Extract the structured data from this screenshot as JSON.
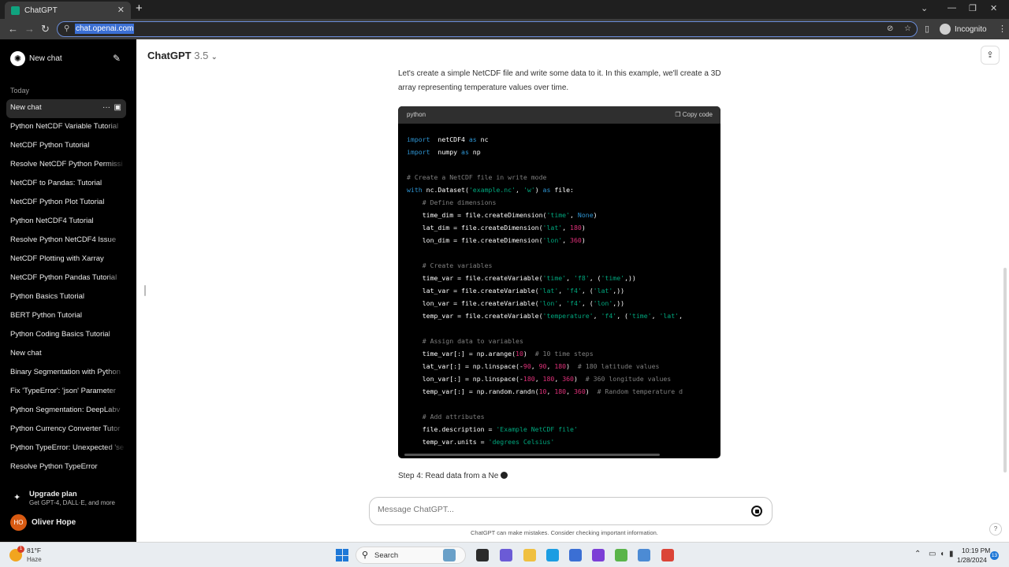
{
  "browser": {
    "tab_title": "ChatGPT",
    "tab_close": "✕",
    "new_tab": "+",
    "url": "chat.openai.com",
    "profile_label": "Incognito",
    "window_controls": [
      "⌄",
      "—",
      "❐",
      "✕"
    ]
  },
  "sidebar": {
    "new_chat_label": "New chat",
    "section_label": "Today",
    "items": [
      {
        "label": "New chat",
        "active": true
      },
      {
        "label": "Python NetCDF Variable Tutorial"
      },
      {
        "label": "NetCDF Python Tutorial"
      },
      {
        "label": "Resolve NetCDF Python Permissi"
      },
      {
        "label": "NetCDF to Pandas: Tutorial"
      },
      {
        "label": "NetCDF Python Plot Tutorial"
      },
      {
        "label": "Python NetCDF4 Tutorial"
      },
      {
        "label": "Resolve Python NetCDF4 Issue"
      },
      {
        "label": "NetCDF Plotting with Xarray"
      },
      {
        "label": "NetCDF Python Pandas Tutorial"
      },
      {
        "label": "Python Basics Tutorial"
      },
      {
        "label": "BERT Python Tutorial"
      },
      {
        "label": "Python Coding Basics Tutorial"
      },
      {
        "label": "New chat"
      },
      {
        "label": "Binary Segmentation with Python"
      },
      {
        "label": "Fix 'TypeError': 'json' Parameter"
      },
      {
        "label": "Python Segmentation: DeepLabv"
      },
      {
        "label": "Python Currency Converter Tutor"
      },
      {
        "label": "Python TypeError: Unexpected 'se"
      },
      {
        "label": "Resolve Python TypeError"
      }
    ],
    "upgrade_title": "Upgrade plan",
    "upgrade_subtitle": "Get GPT-4, DALL·E, and more",
    "user_initials": "HO",
    "user_name": "Oliver Hope"
  },
  "main": {
    "model_name": "ChatGPT",
    "model_version": " 3.5",
    "intro_text": "Let's create a simple NetCDF file and write some data to it. In this example, we'll create a 3D array representing temperature values over time.",
    "code_language": "python",
    "copy_label": "Copy code",
    "code_lines": [
      [
        [
          "kw",
          "import"
        ],
        [
          "",
          "  netCDF4 "
        ],
        [
          "kw",
          "as"
        ],
        [
          "",
          " nc"
        ]
      ],
      [
        [
          "kw",
          "import"
        ],
        [
          "",
          "  numpy "
        ],
        [
          "kw",
          "as"
        ],
        [
          "",
          " np"
        ]
      ],
      [],
      [
        [
          "cm",
          "# Create a NetCDF file in write mode"
        ]
      ],
      [
        [
          "kw",
          "with"
        ],
        [
          "",
          " nc.Dataset("
        ],
        [
          "st",
          "'example.nc'"
        ],
        [
          "",
          ", "
        ],
        [
          "st",
          "'w'"
        ],
        [
          "",
          ") "
        ],
        [
          "kw",
          "as"
        ],
        [
          "",
          " file:"
        ]
      ],
      [
        [
          "cm",
          "    # Define dimensions"
        ]
      ],
      [
        [
          "",
          "    time_dim = file.createDimension("
        ],
        [
          "st",
          "'time'"
        ],
        [
          "",
          ", "
        ],
        [
          "kw",
          "None"
        ],
        [
          "",
          ")"
        ]
      ],
      [
        [
          "",
          "    lat_dim = file.createDimension("
        ],
        [
          "st",
          "'lat'"
        ],
        [
          "",
          ", "
        ],
        [
          "nm",
          "180"
        ],
        [
          "",
          ")"
        ]
      ],
      [
        [
          "",
          "    lon_dim = file.createDimension("
        ],
        [
          "st",
          "'lon'"
        ],
        [
          "",
          ", "
        ],
        [
          "nm",
          "360"
        ],
        [
          "",
          ")"
        ]
      ],
      [],
      [
        [
          "cm",
          "    # Create variables"
        ]
      ],
      [
        [
          "",
          "    time_var = file.createVariable("
        ],
        [
          "st",
          "'time'"
        ],
        [
          "",
          ", "
        ],
        [
          "st",
          "'f8'"
        ],
        [
          "",
          ", ("
        ],
        [
          "st",
          "'time'"
        ],
        [
          "",
          ",))"
        ]
      ],
      [
        [
          "",
          "    lat_var = file.createVariable("
        ],
        [
          "st",
          "'lat'"
        ],
        [
          "",
          ", "
        ],
        [
          "st",
          "'f4'"
        ],
        [
          "",
          ", ("
        ],
        [
          "st",
          "'lat'"
        ],
        [
          "",
          ",))"
        ]
      ],
      [
        [
          "",
          "    lon_var = file.createVariable("
        ],
        [
          "st",
          "'lon'"
        ],
        [
          "",
          ", "
        ],
        [
          "st",
          "'f4'"
        ],
        [
          "",
          ", ("
        ],
        [
          "st",
          "'lon'"
        ],
        [
          "",
          ",))"
        ]
      ],
      [
        [
          "",
          "    temp_var = file.createVariable("
        ],
        [
          "st",
          "'temperature'"
        ],
        [
          "",
          ", "
        ],
        [
          "st",
          "'f4'"
        ],
        [
          "",
          ", ("
        ],
        [
          "st",
          "'time'"
        ],
        [
          "",
          ", "
        ],
        [
          "st",
          "'lat'"
        ],
        [
          "",
          ","
        ]
      ],
      [],
      [
        [
          "cm",
          "    # Assign data to variables"
        ]
      ],
      [
        [
          "",
          "    time_var[:] = np.arange("
        ],
        [
          "nm",
          "10"
        ],
        [
          "",
          ")  "
        ],
        [
          "cm",
          "# 10 time steps"
        ]
      ],
      [
        [
          "",
          "    lat_var[:] = np.linspace(-"
        ],
        [
          "nm",
          "90"
        ],
        [
          "",
          ", "
        ],
        [
          "nm",
          "90"
        ],
        [
          "",
          ", "
        ],
        [
          "nm",
          "180"
        ],
        [
          "",
          ")  "
        ],
        [
          "cm",
          "# 180 latitude values"
        ]
      ],
      [
        [
          "",
          "    lon_var[:] = np.linspace(-"
        ],
        [
          "nm",
          "180"
        ],
        [
          "",
          ", "
        ],
        [
          "nm",
          "180"
        ],
        [
          "",
          ", "
        ],
        [
          "nm",
          "360"
        ],
        [
          "",
          ")  "
        ],
        [
          "cm",
          "# 360 longitude values"
        ]
      ],
      [
        [
          "",
          "    temp_var[:] = np.random.randn("
        ],
        [
          "nm",
          "10"
        ],
        [
          "",
          ", "
        ],
        [
          "nm",
          "180"
        ],
        [
          "",
          ", "
        ],
        [
          "nm",
          "360"
        ],
        [
          "",
          ")  "
        ],
        [
          "cm",
          "# Random temperature d"
        ]
      ],
      [],
      [
        [
          "cm",
          "    # Add attributes"
        ]
      ],
      [
        [
          "",
          "    file.description = "
        ],
        [
          "st",
          "'Example NetCDF file'"
        ]
      ],
      [
        [
          "",
          "    temp_var.units = "
        ],
        [
          "st",
          "'degrees Celsius'"
        ]
      ]
    ],
    "step_text": "Step 4: Read data from a Ne",
    "composer_placeholder": "Message ChatGPT...",
    "disclaimer": "ChatGPT can make mistakes. Consider checking important information.",
    "help_label": "?"
  },
  "taskbar": {
    "weather_badge": "1",
    "temperature": "81°F",
    "condition": "Haze",
    "search_label": "Search",
    "time": "10:19 PM",
    "date": "1/28/2024",
    "notification_count": "13",
    "apps": [
      {
        "icon": "people-app-icon",
        "color": "#6aa0c8"
      },
      {
        "icon": "task-view-icon",
        "color": "#2b2b2b"
      },
      {
        "icon": "chat-icon",
        "color": "#6b5bd6"
      },
      {
        "icon": "file-explorer-icon",
        "color": "#f0c040"
      },
      {
        "icon": "edge-icon",
        "color": "#1b9de2"
      },
      {
        "icon": "store-icon",
        "color": "#3b6fd4"
      },
      {
        "icon": "vpn-icon",
        "color": "#7c3fd6"
      },
      {
        "icon": "notepad-icon",
        "color": "#5ab44a"
      },
      {
        "icon": "photos-icon",
        "color": "#4c8bd4"
      },
      {
        "icon": "chrome-icon",
        "color": "#db4437"
      }
    ]
  }
}
